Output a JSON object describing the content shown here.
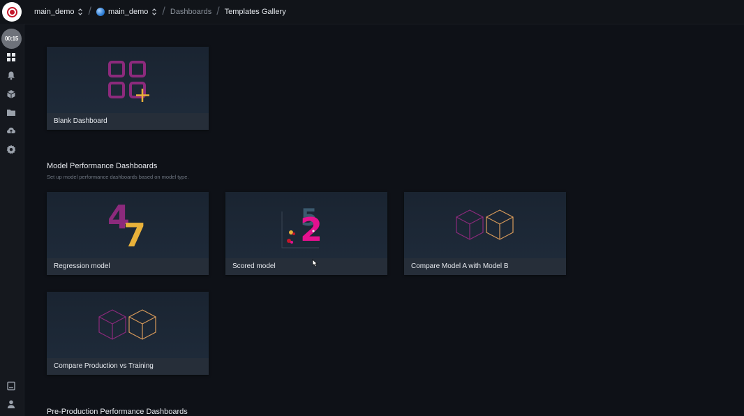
{
  "topbar": {
    "space": "main_demo",
    "model": "main_demo",
    "breadcrumb_parent": "Dashboards",
    "breadcrumb_current": "Templates Gallery"
  },
  "sidebar": {
    "timer": "00:15",
    "items": [
      "dashboards-icon",
      "alerts-icon",
      "models-icon",
      "folder-icon",
      "upload-icon",
      "settings-icon"
    ],
    "bottom_items": [
      "docs-icon",
      "user-icon"
    ]
  },
  "blank": {
    "label": "Blank Dashboard"
  },
  "model_performance": {
    "title": "Model Performance Dashboards",
    "subtitle": "Set up model performance dashboards based on model type.",
    "cards": [
      {
        "label": "Regression model"
      },
      {
        "label": "Scored model"
      },
      {
        "label": "Compare Model A with Model B"
      },
      {
        "label": "Compare Production vs Training"
      }
    ]
  },
  "pre_production": {
    "title": "Pre-Production Performance Dashboards"
  },
  "colors": {
    "accent_red": "#c4162a",
    "magenta": "#8c2a7c",
    "gold": "#e8b13a",
    "pink": "#e5118f"
  }
}
